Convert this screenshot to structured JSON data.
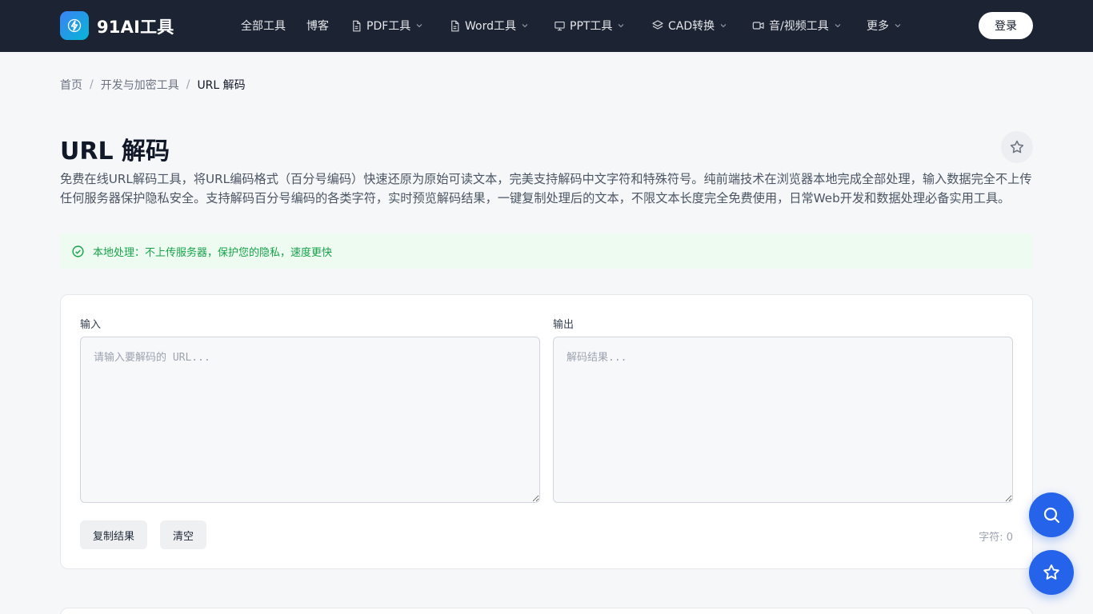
{
  "header": {
    "brand": "91AI工具",
    "nav": [
      {
        "label": "全部工具",
        "icon": "",
        "dropdown": false
      },
      {
        "label": "博客",
        "icon": "",
        "dropdown": false
      },
      {
        "label": "PDF工具",
        "icon": "document-icon",
        "dropdown": true
      },
      {
        "label": "Word工具",
        "icon": "document-icon",
        "dropdown": true
      },
      {
        "label": "PPT工具",
        "icon": "presentation-icon",
        "dropdown": true
      },
      {
        "label": "CAD转换",
        "icon": "layers-icon",
        "dropdown": true
      },
      {
        "label": "音/视频工具",
        "icon": "video-icon",
        "dropdown": true
      },
      {
        "label": "更多",
        "icon": "",
        "dropdown": true
      }
    ],
    "login_label": "登录"
  },
  "breadcrumb": {
    "items": [
      "首页",
      "开发与加密工具",
      "URL 解码"
    ],
    "separator": "/"
  },
  "page": {
    "title": "URL 解码",
    "description": "免费在线URL解码工具，将URL编码格式（百分号编码）快速还原为原始可读文本，完美支持解码中文字符和特殊符号。纯前端技术在浏览器本地完成全部处理，输入数据完全不上传任何服务器保护隐私安全。支持解码百分号编码的各类字符，实时预览解码结果，一键复制处理后的文本，不限文本长度完全免费使用，日常Web开发和数据处理必备实用工具。",
    "notice": "本地处理：不上传服务器，保护您的隐私，速度更快"
  },
  "tool": {
    "input_label": "输入",
    "input_placeholder": "请输入要解码的 URL...",
    "input_value": "",
    "output_label": "输出",
    "output_placeholder": "解码结果...",
    "output_value": "",
    "copy_label": "复制结果",
    "clear_label": "清空",
    "char_count": "字符: 0"
  },
  "colors": {
    "header_bg": "#1c2333",
    "accent": "#2563eb",
    "notice_bg": "#eefbf1",
    "notice_text": "#16a34a"
  }
}
